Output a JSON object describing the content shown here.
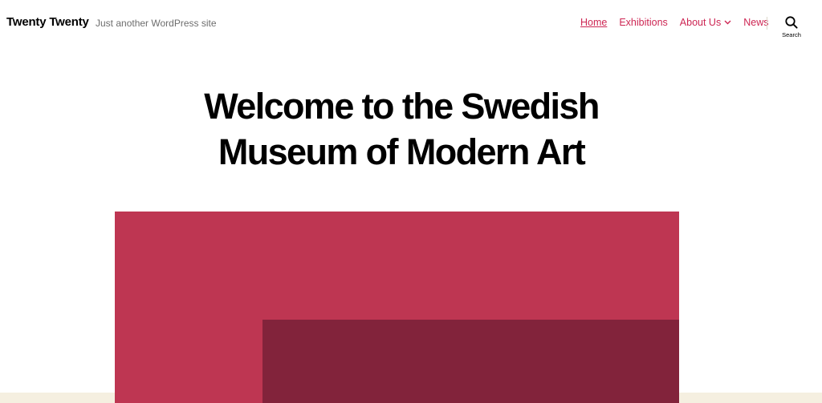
{
  "header": {
    "site_title": "Twenty Twenty",
    "site_description": "Just another WordPress site",
    "nav": {
      "home": "Home",
      "exhibitions": "Exhibitions",
      "about_us": "About Us",
      "news": "News"
    },
    "search_label": "Search"
  },
  "main": {
    "title_line1": "Welcome to the Swedish",
    "title_line2": "Museum of Modern Art"
  },
  "colors": {
    "accent": "#cd2653",
    "art_primary": "#be3652",
    "art_secondary": "#82233b",
    "footer_band": "#f5efe0"
  },
  "icons": {
    "search": "search-icon",
    "dropdown": "chevron-down-icon"
  }
}
